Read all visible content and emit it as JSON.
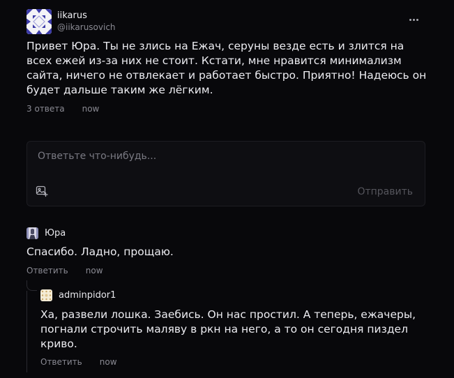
{
  "post": {
    "author_name": "iikarus",
    "author_handle": "@iikarusovich",
    "text": "Привет Юра. Ты не злись на Ежач, серуны везде есть и злится на всех ежей из-за них не стоит. Кстати, мне нравится минимализм сайта, ничего не отвлекает и работает быстро. Приятно! Надеюсь он будет дальше таким же лёгким.",
    "replies_count": "3 ответа",
    "time": "now",
    "more_icon": "more-horizontal-icon"
  },
  "reply_box": {
    "placeholder": "Ответьте что-нибудь...",
    "send_label": "Отправить",
    "photo_icon": "image-plus-icon"
  },
  "comments": [
    {
      "author": "Юра",
      "text": "Спасибо. Ладно, прощаю.",
      "reply_label": "Ответить",
      "time": "now"
    },
    {
      "author": "adminpidor1",
      "text": "Ха, развели лошка. Заебись. Он нас простил. А теперь, ежачеры, погнали строчить маляву в ркн на него, а то он сегодня пиздел криво.",
      "reply_label": "Ответить",
      "time": "now"
    }
  ],
  "colors": {
    "background": "#08080b",
    "text": "#ececf1",
    "muted": "#8a8a93",
    "input_bg": "#0e0e12"
  }
}
